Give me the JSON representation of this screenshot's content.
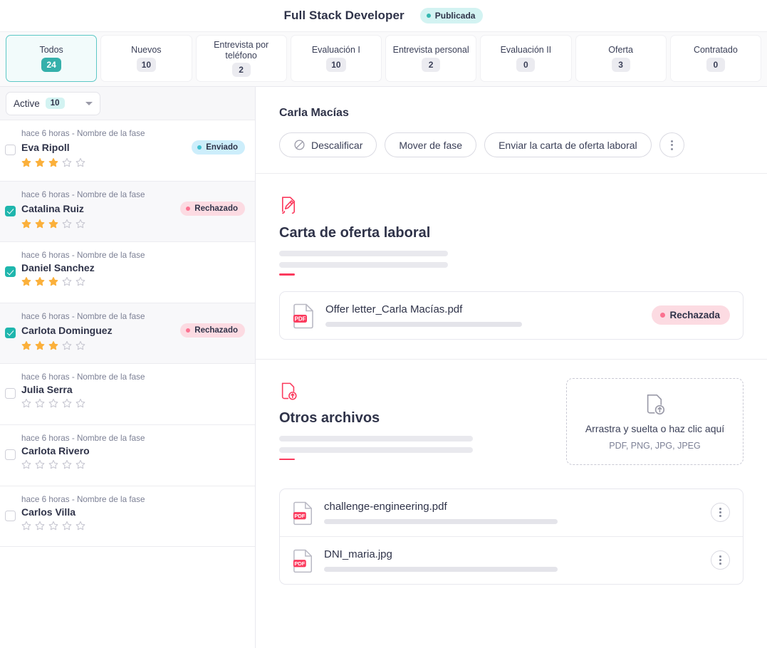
{
  "header": {
    "job_title": "Full Stack Developer",
    "status_badge": "Publicada",
    "status_color": "#35b8b1"
  },
  "stage_tabs": [
    {
      "label": "Todos",
      "count": "24",
      "active": true
    },
    {
      "label": "Nuevos",
      "count": "10",
      "active": false
    },
    {
      "label": "Entrevista por teléfono",
      "count": "2",
      "active": false
    },
    {
      "label": "Evaluación I",
      "count": "10",
      "active": false
    },
    {
      "label": "Entrevista personal",
      "count": "2",
      "active": false
    },
    {
      "label": "Evaluación II",
      "count": "0",
      "active": false
    },
    {
      "label": "Oferta",
      "count": "3",
      "active": false
    },
    {
      "label": "Contratado",
      "count": "0",
      "active": false
    }
  ],
  "sidebar": {
    "filter": {
      "label": "Active",
      "count": "10",
      "icon": "chevron-down-icon"
    },
    "candidates": [
      {
        "meta": "hace 6 horas - Nombre de la fase",
        "name": "Eva Ripoll",
        "checked": false,
        "selected": false,
        "rating": 3,
        "badge": "Enviado",
        "badge_type": "sent"
      },
      {
        "meta": "hace 6 horas - Nombre de la fase",
        "name": "Catalina Ruiz",
        "checked": true,
        "selected": true,
        "rating": 3,
        "badge": "Rechazado",
        "badge_type": "rej"
      },
      {
        "meta": "hace 6 horas - Nombre de la fase",
        "name": "Daniel Sanchez",
        "checked": true,
        "selected": false,
        "rating": 3,
        "badge": "",
        "badge_type": ""
      },
      {
        "meta": "hace 6 horas - Nombre de la fase",
        "name": "Carlota Dominguez",
        "checked": true,
        "selected": true,
        "rating": 3,
        "badge": "Rechazado",
        "badge_type": "rej"
      },
      {
        "meta": "hace 6 horas - Nombre de la fase",
        "name": "Julia Serra",
        "checked": false,
        "selected": false,
        "rating": 0,
        "badge": "",
        "badge_type": ""
      },
      {
        "meta": "hace 6 horas - Nombre de la fase",
        "name": "Carlota Rivero",
        "checked": false,
        "selected": false,
        "rating": 0,
        "badge": "",
        "badge_type": ""
      },
      {
        "meta": "hace 6 horas - Nombre de la fase",
        "name": "Carlos Villa",
        "checked": false,
        "selected": false,
        "rating": 0,
        "badge": "",
        "badge_type": ""
      }
    ]
  },
  "detail": {
    "candidate_name": "Carla Macías",
    "actions": {
      "disqualify": "Descalificar",
      "disqualify_icon": "ban-icon",
      "move_stage": "Mover de fase",
      "send_offer": "Enviar la carta de oferta laboral",
      "more_icon": "kebab-menu-icon"
    },
    "offer_section": {
      "icon": "signed-document-icon",
      "title": "Carta de oferta laboral",
      "file": {
        "icon": "pdf-file-icon",
        "name": "Offer letter_Carla Macías.pdf",
        "status_badge": "Rechazada",
        "status_color": "#fb3a5d"
      }
    },
    "other_files_section": {
      "icon": "file-upload-icon",
      "title": "Otros archivos",
      "dropzone": {
        "icon": "file-upload-icon",
        "title": "Arrastra y suelta o haz clic aquí",
        "subtitle": "PDF, PNG, JPG, JPEG"
      },
      "files": [
        {
          "icon": "pdf-file-icon",
          "name": "challenge-engineering.pdf",
          "menu_icon": "kebab-menu-icon"
        },
        {
          "icon": "pdf-file-icon",
          "name": "DNI_maria.jpg",
          "menu_icon": "kebab-menu-icon"
        }
      ]
    }
  },
  "colors": {
    "accent_teal": "#35b0ab",
    "accent_red": "#fb3a5d",
    "star_filled": "#fbb03b",
    "star_empty": "#c8c8d2"
  }
}
